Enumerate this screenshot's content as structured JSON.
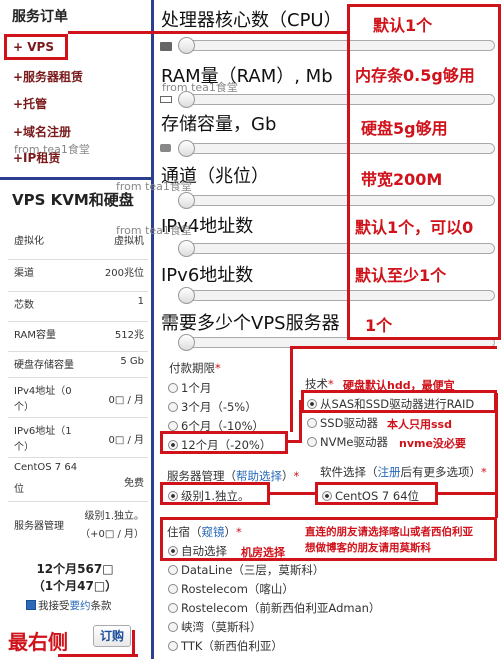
{
  "sidebar": {
    "order_title": "服务订单",
    "menu": [
      "+ VPS",
      "+服务器租赁",
      "+托管",
      "+域名注册",
      "+IP租赁"
    ],
    "summary_title": "VPS KVM和硬盘",
    "specs": [
      {
        "k": "虚拟化",
        "v": "虚拟机"
      },
      {
        "k": "渠道",
        "v": "200兆位"
      },
      {
        "k": "芯数",
        "v": "1"
      },
      {
        "k": "RAM容量",
        "v": "512兆"
      },
      {
        "k": "硬盘存储容量",
        "v": "5 Gb"
      },
      {
        "k": "IPv4地址（0",
        "k2": "个）",
        "v": "0□ / 月"
      },
      {
        "k": "IPv6地址（1",
        "k2": "个）",
        "v": "0□ / 月"
      },
      {
        "k": "CentOS 7 64",
        "k2": "位",
        "v": "免费"
      },
      {
        "k": "服务器管理",
        "v": "级别1.独立。",
        "v2": "（+0□ / 月）"
      }
    ],
    "price_line1": "12个月567□",
    "price_line2": "（1个月47□）",
    "agree_pre": "我接受",
    "agree_link": "要约",
    "agree_post": "条款",
    "order_button": "订购",
    "rightmost_annot": "最右侧"
  },
  "params": [
    {
      "label": "处理器核心数（CPU）",
      "annot": "默认1个",
      "icon": "chip-icon"
    },
    {
      "label": "RAM量（RAM）, Mb",
      "annot": "内存条0.5g够用",
      "icon": "ram-icon"
    },
    {
      "label": "存储容量，Gb",
      "annot": "硬盘5g够用",
      "icon": "disk-icon"
    },
    {
      "label": "通道（兆位）",
      "annot": "带宽200M",
      "icon": ""
    },
    {
      "label": "IPv4地址数",
      "annot": "默认1个，可以0",
      "icon": ""
    },
    {
      "label": "IPv6地址数",
      "annot": "默认至少1个",
      "icon": ""
    },
    {
      "label": "需要多少个VPS服务器",
      "annot": "1个",
      "icon": ""
    }
  ],
  "payment": {
    "title": "付款期限",
    "options": [
      "1个月",
      "3个月（-5%）",
      "6个月（-10%）",
      "12个月（-20%）"
    ],
    "selected": 3
  },
  "tech": {
    "title": "技术",
    "annot": "硬盘默认hdd，最便宜",
    "options": [
      "从SAS和SSD驱动器进行RAID",
      "SSD驱动器",
      "NVMe驱动器"
    ],
    "ssd_annot": "本人只用ssd",
    "nvme_annot": "nvme没必要"
  },
  "mgmt": {
    "title": "服务器管理",
    "link": "帮助选择",
    "option": "级别1.独立。"
  },
  "software": {
    "title": "软件选择",
    "link": "注册",
    "rest": "后有更多选项",
    "option": "CentOS 7 64位"
  },
  "location": {
    "title": "住宿",
    "link": "窥镜",
    "options": [
      "自动选择",
      "DataLine（三层，莫斯科）",
      "Rostelecom（喀山）",
      "Rostelecom（前新西伯利亚Adman）",
      "峡湾（莫斯科）",
      "TTK（新西伯利亚）"
    ],
    "auto_annot": "机房选择",
    "annot_line1": "直连的朋友请选择喀山或者西伯利亚",
    "annot_line2": "想做博客的朋友请用莫斯科"
  },
  "watermark": "from tea1食堂"
}
